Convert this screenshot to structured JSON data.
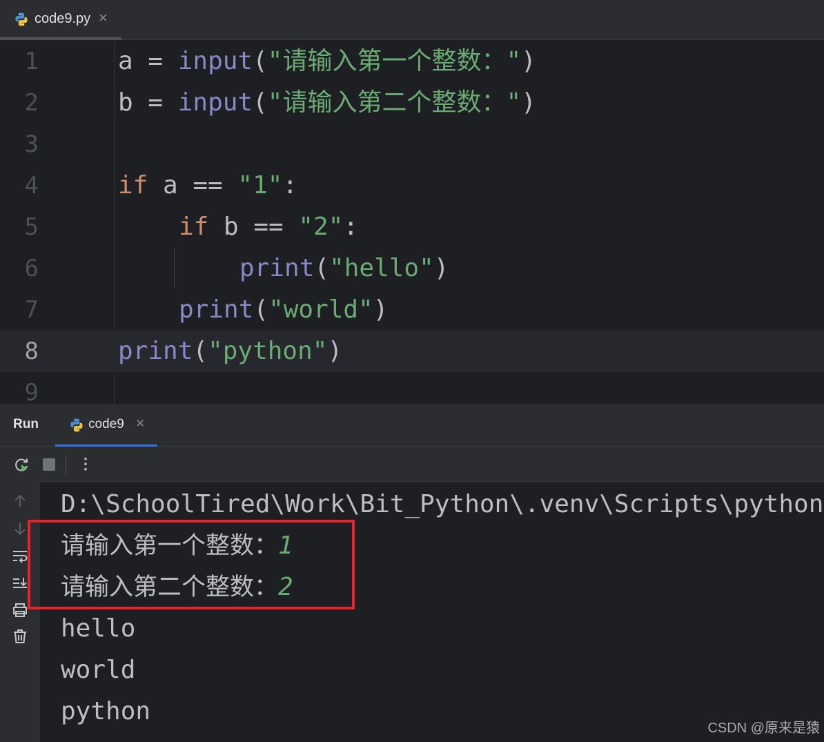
{
  "editor_tab": {
    "filename": "code9.py",
    "close": "×",
    "icon": "python-icon"
  },
  "code": {
    "line_numbers": [
      "1",
      "2",
      "3",
      "4",
      "5",
      "6",
      "7",
      "8",
      "9"
    ],
    "current_line": "8",
    "lines": [
      {
        "var": "a",
        "op": " = ",
        "fn": "input",
        "open": "(",
        "str_q1": "\"",
        "str_body": "请输入第一个整数：",
        "str_q2": "\"",
        "close": ")"
      },
      {
        "var": "b",
        "op": " = ",
        "fn": "input",
        "open": "(",
        "str_q1": "\"",
        "str_body": "请输入第二个整数：",
        "str_q2": "\"",
        "close": ")"
      },
      {},
      {
        "kw": "if",
        "rest": " a == ",
        "str": "\"1\"",
        "end": ":"
      },
      {
        "kw": "if",
        "rest": " b == ",
        "str": "\"2\"",
        "end": ":"
      },
      {
        "fn": "print",
        "open": "(",
        "str": "\"hello\"",
        "close": ")"
      },
      {
        "fn": "print",
        "open": "(",
        "str": "\"world\"",
        "close": ")"
      },
      {
        "fn": "print",
        "open": "(",
        "str": "\"python\"",
        "close": ")"
      },
      {}
    ]
  },
  "run_panel": {
    "title": "Run",
    "tab_label": "code9",
    "close": "×",
    "more": "⋮"
  },
  "console": {
    "path_line": "D:\\SchoolTired\\Work\\Bit_Python\\.venv\\Scripts\\python",
    "prompt1": "请输入第一个整数：",
    "input1": "1",
    "prompt2": "请输入第二个整数：",
    "input2": "2",
    "out1": "hello",
    "out2": "world",
    "out3": "python"
  },
  "watermark": "CSDN @原来是猿",
  "colors": {
    "background": "#1e1f22",
    "keyword": "#cf8e6d",
    "builtin": "#8888c6",
    "string": "#6aab73",
    "highlight_box": "#e8232b",
    "tab_accent": "#3574f0"
  }
}
